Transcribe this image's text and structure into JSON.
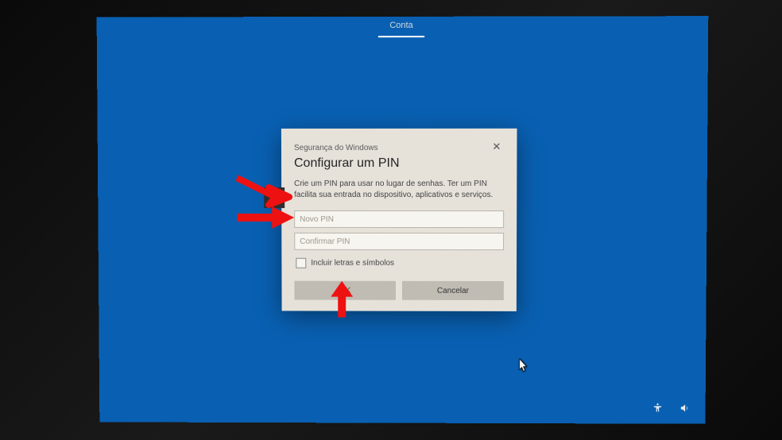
{
  "tab": {
    "label": "Conta"
  },
  "dialog": {
    "subtitle": "Segurança do Windows",
    "title": "Configurar um PIN",
    "description": "Crie um PIN para usar no lugar de senhas. Ter um PIN facilita sua entrada no dispositivo, aplicativos e serviços.",
    "new_pin_placeholder": "Novo PIN",
    "confirm_pin_placeholder": "Confirmar PIN",
    "checkbox_label": "Incluir letras e símbolos",
    "ok_label": "OK",
    "cancel_label": "Cancelar",
    "close_symbol": "✕"
  }
}
